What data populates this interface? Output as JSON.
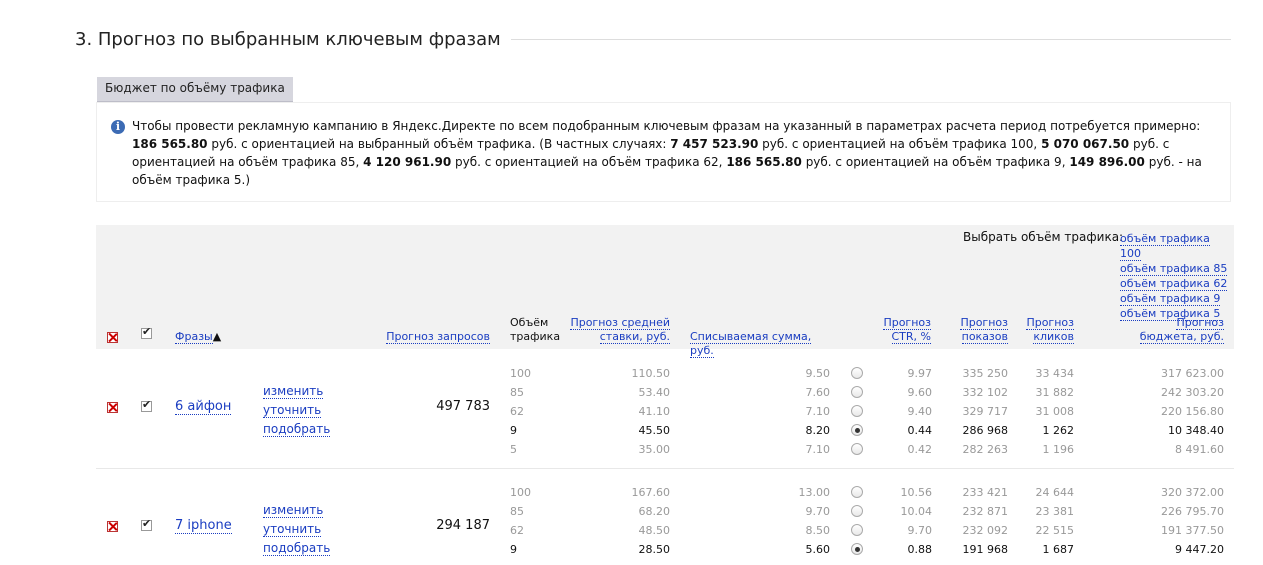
{
  "section": {
    "title": "3. Прогноз по выбранным ключевым фразам"
  },
  "tab": {
    "label": "Бюджет по объёму трафика"
  },
  "info": {
    "line1": "Чтобы провести рекламную кампанию в Яндекс.Директе по всем подобранным ключевым фразам на указанный в параметрах расчета период потребуется примерно:",
    "main_amount": "186 565.80",
    "main_suffix": "руб. с ориентацией на выбранный объём трафика. (В частных случаях:",
    "cases": [
      {
        "amount": "7 457 523.90",
        "text": "руб. с ориентацией на объём трафика 100,"
      },
      {
        "amount": "5 070 067.50",
        "text": "руб. с ориентацией на объём трафика 85,"
      },
      {
        "amount": "4 120 961.90",
        "text": "руб. с ориентацией на объём трафика 62,"
      },
      {
        "amount": "186 565.80",
        "text": "руб. с ориентацией на объём трафика 9,"
      },
      {
        "amount": "149 896.00",
        "text": "руб. - на объём трафика 5.)"
      }
    ]
  },
  "header": {
    "select_volume_label": "Выбрать объём трафика:",
    "volume_links": [
      "объём трафика 100",
      "объём трафика 85",
      "объём трафика 62",
      "объём трафика 9",
      "объём трафика 5"
    ],
    "col_phrases": "Фразы",
    "sort_arrow": "▲",
    "col_queries": "Прогноз запросов",
    "col_volume_1": "Объём",
    "col_volume_2": "трафика",
    "col_bid_1": "Прогноз средней",
    "col_bid_2": "ставки, руб.",
    "col_charge": "Списываемая сумма, руб.",
    "col_ctr_1": "Прогноз",
    "col_ctr_2": "CTR, %",
    "col_impr_1": "Прогноз",
    "col_impr_2": "показов",
    "col_clicks_1": "Прогноз",
    "col_clicks_2": "кликов",
    "col_budget_1": "Прогноз",
    "col_budget_2": "бюджета, руб."
  },
  "actions": {
    "edit": "изменить",
    "refine": "уточнить",
    "pick": "подобрать"
  },
  "rows": [
    {
      "phrase": "6 айфон",
      "queries": "497 783",
      "selected_index": 3,
      "levels": [
        {
          "volume": "100",
          "bid": "110.50",
          "charge": "9.50",
          "ctr": "9.97",
          "impressions": "335 250",
          "clicks": "33 434",
          "budget": "317 623.00"
        },
        {
          "volume": "85",
          "bid": "53.40",
          "charge": "7.60",
          "ctr": "9.60",
          "impressions": "332 102",
          "clicks": "31 882",
          "budget": "242 303.20"
        },
        {
          "volume": "62",
          "bid": "41.10",
          "charge": "7.10",
          "ctr": "9.40",
          "impressions": "329 717",
          "clicks": "31 008",
          "budget": "220 156.80"
        },
        {
          "volume": "9",
          "bid": "45.50",
          "charge": "8.20",
          "ctr": "0.44",
          "impressions": "286 968",
          "clicks": "1 262",
          "budget": "10 348.40"
        },
        {
          "volume": "5",
          "bid": "35.00",
          "charge": "7.10",
          "ctr": "0.42",
          "impressions": "282 263",
          "clicks": "1 196",
          "budget": "8 491.60"
        }
      ]
    },
    {
      "phrase": "7 iphone",
      "queries": "294 187",
      "selected_index": 3,
      "levels": [
        {
          "volume": "100",
          "bid": "167.60",
          "charge": "13.00",
          "ctr": "10.56",
          "impressions": "233 421",
          "clicks": "24 644",
          "budget": "320 372.00"
        },
        {
          "volume": "85",
          "bid": "68.20",
          "charge": "9.70",
          "ctr": "10.04",
          "impressions": "232 871",
          "clicks": "23 381",
          "budget": "226 795.70"
        },
        {
          "volume": "62",
          "bid": "48.50",
          "charge": "8.50",
          "ctr": "9.70",
          "impressions": "232 092",
          "clicks": "22 515",
          "budget": "191 377.50"
        },
        {
          "volume": "9",
          "bid": "28.50",
          "charge": "5.60",
          "ctr": "0.88",
          "impressions": "191 968",
          "clicks": "1 687",
          "budget": "9 447.20"
        }
      ]
    }
  ]
}
